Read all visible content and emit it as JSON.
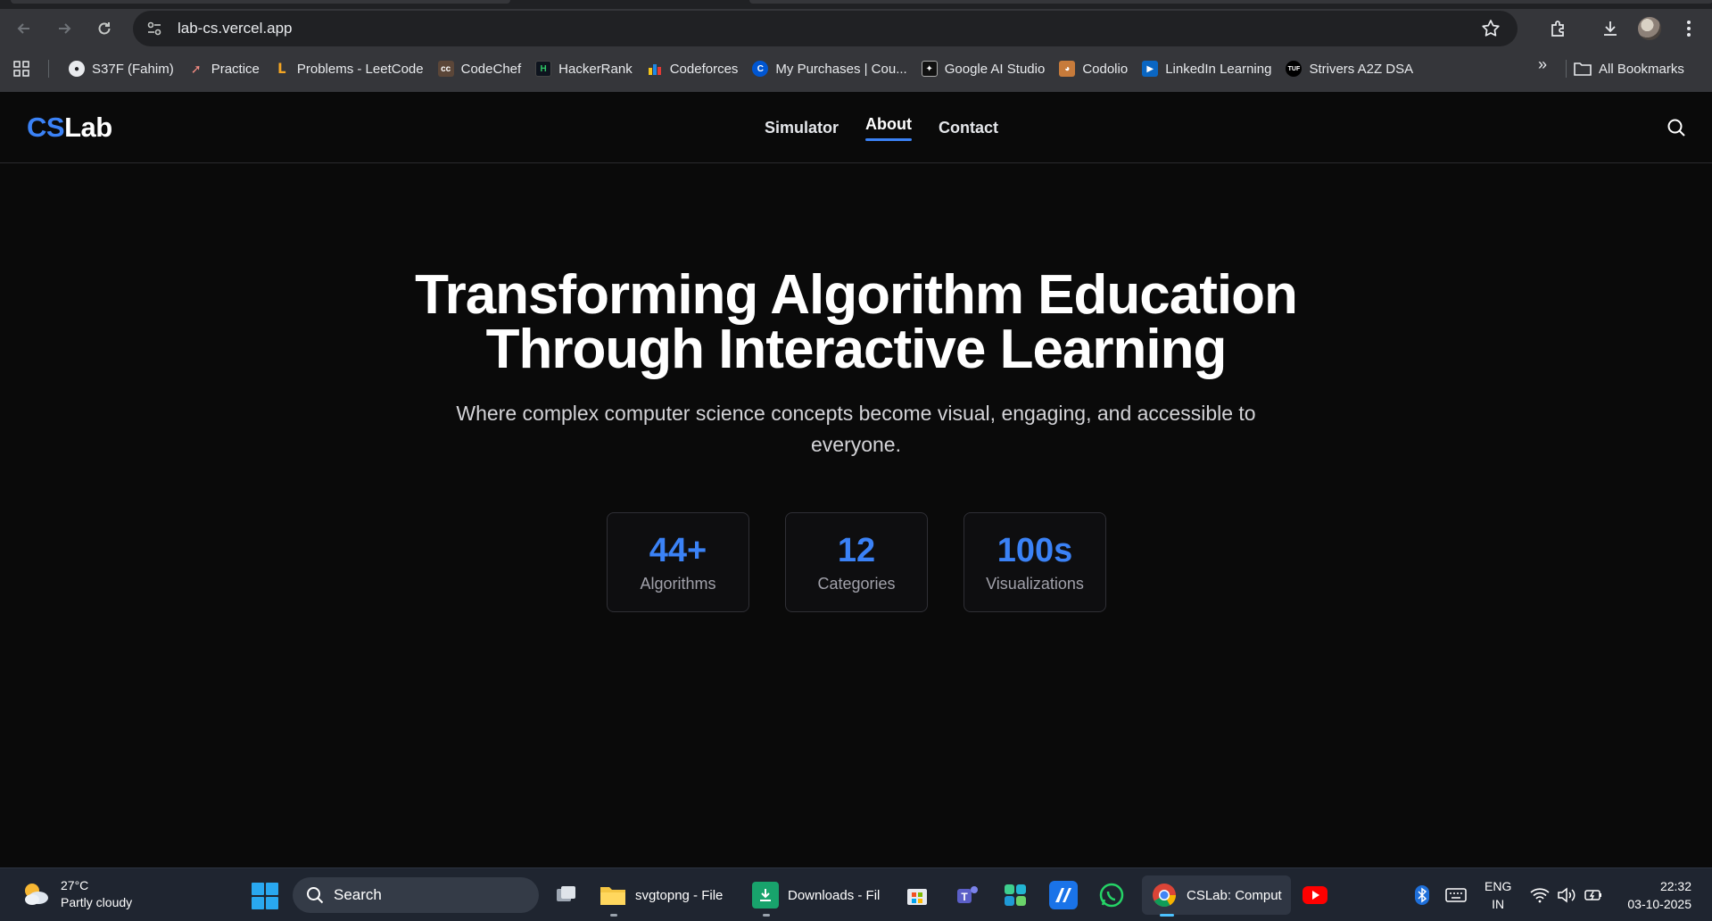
{
  "browser": {
    "url": "lab-cs.vercel.app",
    "bookmarks": [
      {
        "label": "S37F (Fahim)",
        "icon": "github-icon"
      },
      {
        "label": "Practice",
        "icon": "rocket-icon"
      },
      {
        "label": "Problems - LeetCode",
        "icon": "leetcode-icon"
      },
      {
        "label": "CodeChef",
        "icon": "codechef-icon"
      },
      {
        "label": "HackerRank",
        "icon": "hackerrank-icon"
      },
      {
        "label": "Codeforces",
        "icon": "codeforces-icon"
      },
      {
        "label": "My Purchases | Cou...",
        "icon": "coursera-icon"
      },
      {
        "label": "Google AI Studio",
        "icon": "ai-studio-icon"
      },
      {
        "label": "Codolio",
        "icon": "codolio-icon"
      },
      {
        "label": "LinkedIn Learning",
        "icon": "linkedin-learning-icon"
      },
      {
        "label": "Strivers A2Z DSA",
        "icon": "tuf-icon"
      }
    ],
    "all_bookmarks_label": "All Bookmarks"
  },
  "site": {
    "logo_cs": "CS",
    "logo_lab": "Lab",
    "nav": [
      {
        "label": "Simulator",
        "active": false
      },
      {
        "label": "About",
        "active": true
      },
      {
        "label": "Contact",
        "active": false
      }
    ]
  },
  "hero": {
    "title_line1": "Transforming Algorithm Education",
    "title_line2": "Through Interactive Learning",
    "subtitle": "Where complex computer science concepts become visual, engaging, and accessible to everyone.",
    "stats": [
      {
        "value": "44+",
        "label": "Algorithms"
      },
      {
        "value": "12",
        "label": "Categories"
      },
      {
        "value": "100s",
        "label": "Visualizations"
      }
    ]
  },
  "taskbar": {
    "weather_temp": "27°C",
    "weather_desc": "Partly cloudy",
    "search_label": "Search",
    "apps": [
      {
        "label": "svgtopng - File"
      },
      {
        "label": "Downloads - Fil"
      },
      {
        "label": "CSLab: Comput"
      }
    ],
    "lang_line1": "ENG",
    "lang_line2": "IN",
    "time": "22:32",
    "date": "03-10-2025"
  },
  "colors": {
    "accent": "#3b82f6",
    "page_bg": "#0a0a0a",
    "chrome_bg": "#35363a"
  }
}
